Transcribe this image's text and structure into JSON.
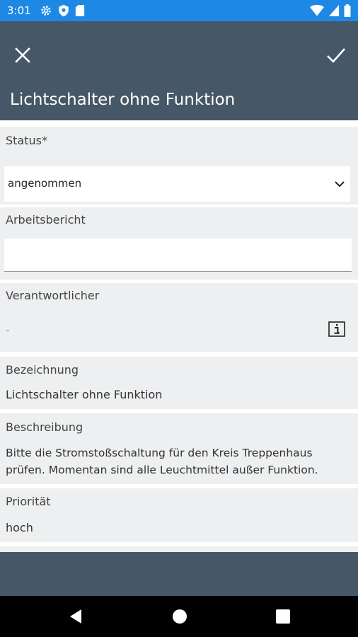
{
  "status_bar": {
    "time": "3:01"
  },
  "header": {
    "title": "Lichtschalter ohne Funktion"
  },
  "form": {
    "status": {
      "label": "Status*",
      "selected": "angenommen"
    },
    "arbeitsbericht": {
      "label": "Arbeitsbericht",
      "value": ""
    },
    "verantwortlicher": {
      "label": "Verantwortlicher",
      "value": "-"
    },
    "bezeichnung": {
      "label": "Bezeichnung",
      "value": "Lichtschalter ohne Funktion"
    },
    "beschreibung": {
      "label": "Beschreibung",
      "line1": "Bitte die Stromstoßschaltung für den Kreis Treppenhaus",
      "line2": "prüfen. Momentan sind alle Leuchtmittel außer Funktion."
    },
    "prioritaet": {
      "label": "Priorität",
      "value": "hoch"
    }
  },
  "colors": {
    "status_bar": "#1e88e5",
    "app_bar": "#465767",
    "section_bg": "#eeeff0",
    "nav_bar": "#000000"
  }
}
